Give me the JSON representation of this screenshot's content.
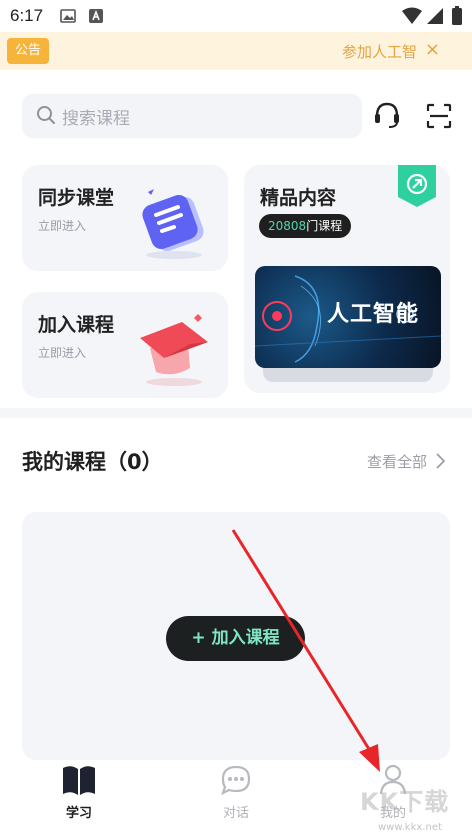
{
  "status_bar": {
    "time": "6:17"
  },
  "notice": {
    "tag": "公告",
    "text": "参加人工智",
    "close": "×"
  },
  "search": {
    "placeholder": "搜索课程"
  },
  "cards": {
    "sync_class": {
      "title": "同步课堂",
      "subtitle": "立即进入"
    },
    "join_course": {
      "title": "加入课程",
      "subtitle": "立即进入"
    },
    "premium": {
      "title": "精品内容",
      "count_number": "20808",
      "count_suffix": "门课程",
      "banner_text": "人工智能"
    }
  },
  "my_courses": {
    "title": "我的课程（0）",
    "view_all": "查看全部"
  },
  "empty_state": {
    "join_button": "+ 加入课程"
  },
  "tabs": [
    {
      "label": "学习",
      "icon": "book-icon",
      "active": true
    },
    {
      "label": "对话",
      "icon": "chat-bubble-icon",
      "active": false
    },
    {
      "label": "我的",
      "icon": "person-icon",
      "active": false
    }
  ],
  "watermark": {
    "text": "KK下载",
    "url": "www.kkx.net"
  },
  "colors": {
    "accent": "#51d6b0",
    "notice_bg": "#fef3dc",
    "notice_text": "#e2a545",
    "tag_bg": "#f6b43b",
    "arrow": "#e8262a"
  }
}
